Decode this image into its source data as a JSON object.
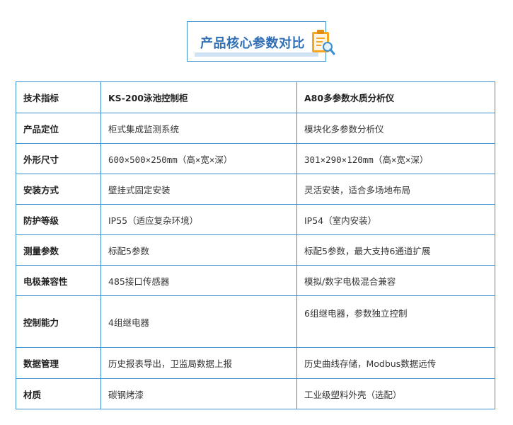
{
  "title": "产品核心参数对比",
  "icon": "report-icon",
  "colors": {
    "border": "#3a8fd1",
    "title": "#2f6db4",
    "underbar": "#cfe3f5",
    "icon_orange": "#f5a623"
  },
  "table": {
    "header": {
      "metric": "技术指标",
      "ks": "KS-200泳池控制柜",
      "a80": "A80多参数水质分析仪"
    },
    "rows": [
      {
        "metric": "产品定位",
        "ks": "柜式集成监测系统",
        "a80": "模块化多参数分析仪"
      },
      {
        "metric": "外形尺寸",
        "ks": "600×500×250mm（高×宽×深）",
        "a80": "301×290×120mm（高×宽×深）"
      },
      {
        "metric": "安装方式",
        "ks": "壁挂式固定安装",
        "a80": "灵活安装，适合多场地布局"
      },
      {
        "metric": "防护等级",
        "ks": "IP55（适应复杂环境）",
        "a80": "IP54（室内安装）"
      },
      {
        "metric": "测量参数",
        "ks": "标配5参数",
        "a80": "标配5参数，最大支持6通道扩展"
      },
      {
        "metric": "电极兼容性",
        "ks": "485接口传感器",
        "a80": "模拟/数字电极混合兼容"
      },
      {
        "metric": "控制能力",
        "ks": "4组继电器",
        "a80": "6组继电器，参数独立控制"
      },
      {
        "metric": "数据管理",
        "ks": "历史报表导出，卫监局数据上报",
        "a80": "历史曲线存储，Modbus数据远传"
      },
      {
        "metric": "材质",
        "ks": "碳钢烤漆",
        "a80": "工业级塑料外壳（选配）"
      }
    ]
  }
}
